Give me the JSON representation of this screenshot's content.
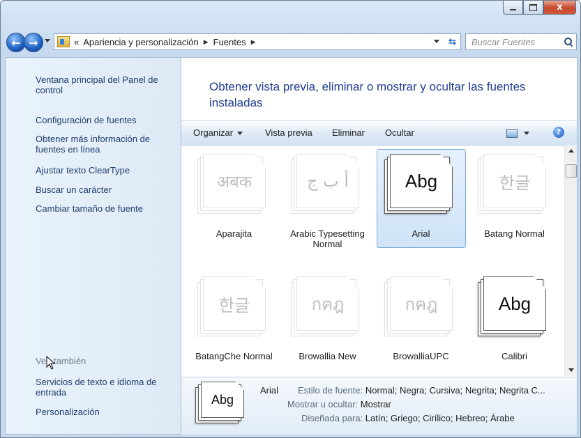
{
  "window": {
    "close_glyph": "x"
  },
  "nav": {
    "back_glyph": "←",
    "forward_glyph": "→",
    "breadcrumb": [
      "Apariencia y personalización",
      "Fuentes"
    ],
    "chevrons": "«",
    "search_placeholder": "Buscar Fuentes"
  },
  "sidebar": {
    "links": [
      "Ventana principal del Panel de control",
      "Configuración de fuentes",
      "Obtener más información de fuentes en línea",
      "Ajustar texto ClearType",
      "Buscar un carácter",
      "Cambiar tamaño de fuente"
    ],
    "see_also_header": "Vea también",
    "see_also": [
      "Servicios de texto e idioma de entrada",
      "Personalización"
    ]
  },
  "main": {
    "heading": "Obtener vista previa, eliminar o mostrar y ocultar las fuentes instaladas"
  },
  "toolbar": {
    "organize": "Organizar",
    "preview": "Vista previa",
    "delete": "Eliminar",
    "hide": "Ocultar",
    "help": "?"
  },
  "fonts": [
    {
      "name": "Aparajita",
      "sample": "अबक",
      "style": "faded",
      "selected": false
    },
    {
      "name": "Arabic Typesetting Normal",
      "sample": "أ ب ج",
      "style": "faded",
      "selected": false
    },
    {
      "name": "Arial",
      "sample": "Abg",
      "style": "strong",
      "selected": true
    },
    {
      "name": "Batang Normal",
      "sample": "한글",
      "style": "faded",
      "selected": false
    },
    {
      "name": "BatangChe Normal",
      "sample": "한글",
      "style": "faded",
      "selected": false
    },
    {
      "name": "Browallia New",
      "sample": "กคฎ",
      "style": "faded",
      "selected": false
    },
    {
      "name": "BrowalliaUPC",
      "sample": "กคฎ",
      "style": "faded",
      "selected": false
    },
    {
      "name": "Calibri",
      "sample": "Abg",
      "style": "strong",
      "selected": false
    }
  ],
  "details": {
    "name": "Arial",
    "sample": "Abg",
    "style_label": "Estilo de fuente:",
    "style_value": "Normal; Negra; Cursiva; Negrita; Negrita C...",
    "show_label": "Mostrar u ocultar:",
    "show_value": "Mostrar",
    "designed_label": "Diseñada para:",
    "designed_value": "Latín; Griego; Cirílico; Hebreo; Árabe"
  }
}
